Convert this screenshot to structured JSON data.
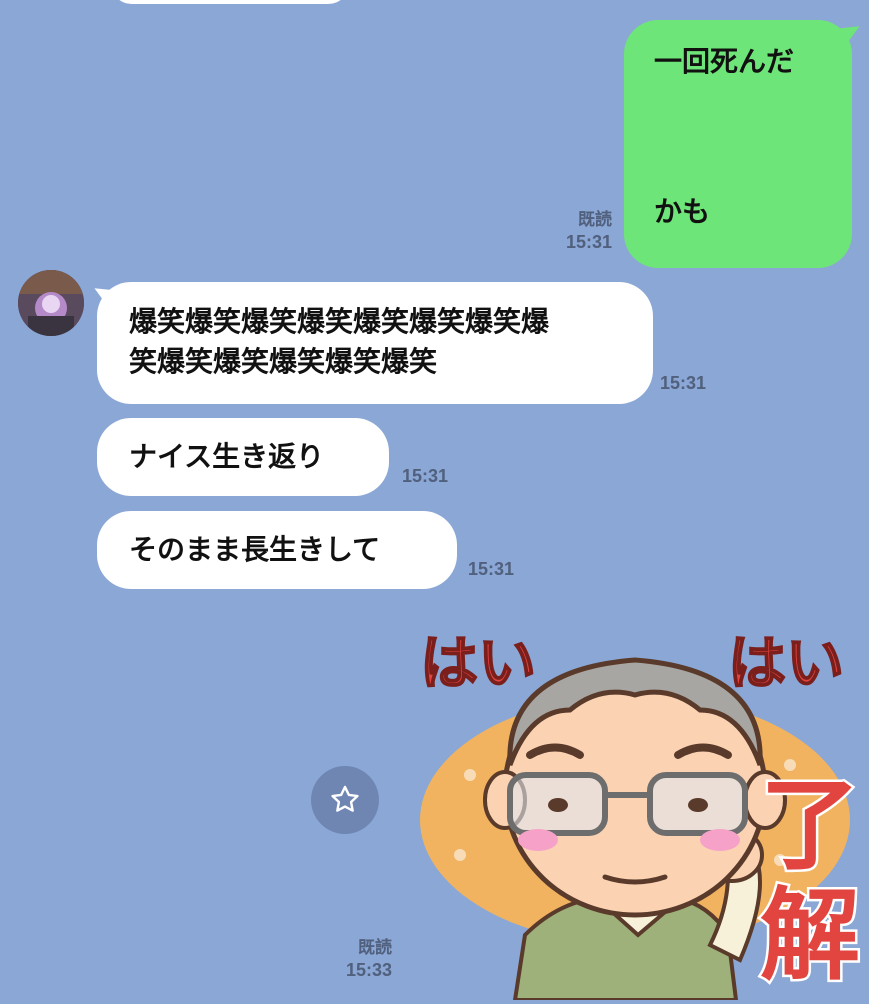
{
  "messages": {
    "top_partial": {},
    "outgoing_1": {
      "line1": "一回死んだ",
      "line2": "かも",
      "read": "既読",
      "time": "15:31"
    },
    "incoming_1": {
      "line1": "爆笑爆笑爆笑爆笑爆笑爆笑爆笑爆",
      "line2": "笑爆笑爆笑爆笑爆笑爆笑",
      "time": "15:31"
    },
    "incoming_2": {
      "text": "ナイス生き返り",
      "time": "15:31"
    },
    "incoming_3": {
      "text": "そのまま長生きして",
      "time": "15:31"
    },
    "sticker_message": {
      "read": "既読",
      "time": "15:33",
      "sticker_text_left": "はい",
      "sticker_text_right": "はい",
      "sticker_text_big_1": "了",
      "sticker_text_big_2": "解"
    }
  },
  "icons": {
    "star": "star-icon",
    "avatar": "avatar"
  },
  "colors": {
    "background": "#8aa7d6",
    "outgoing_bubble": "#6ee578",
    "incoming_bubble": "#ffffff",
    "meta_text": "#50607d",
    "sticker_red": "#e2443f"
  }
}
